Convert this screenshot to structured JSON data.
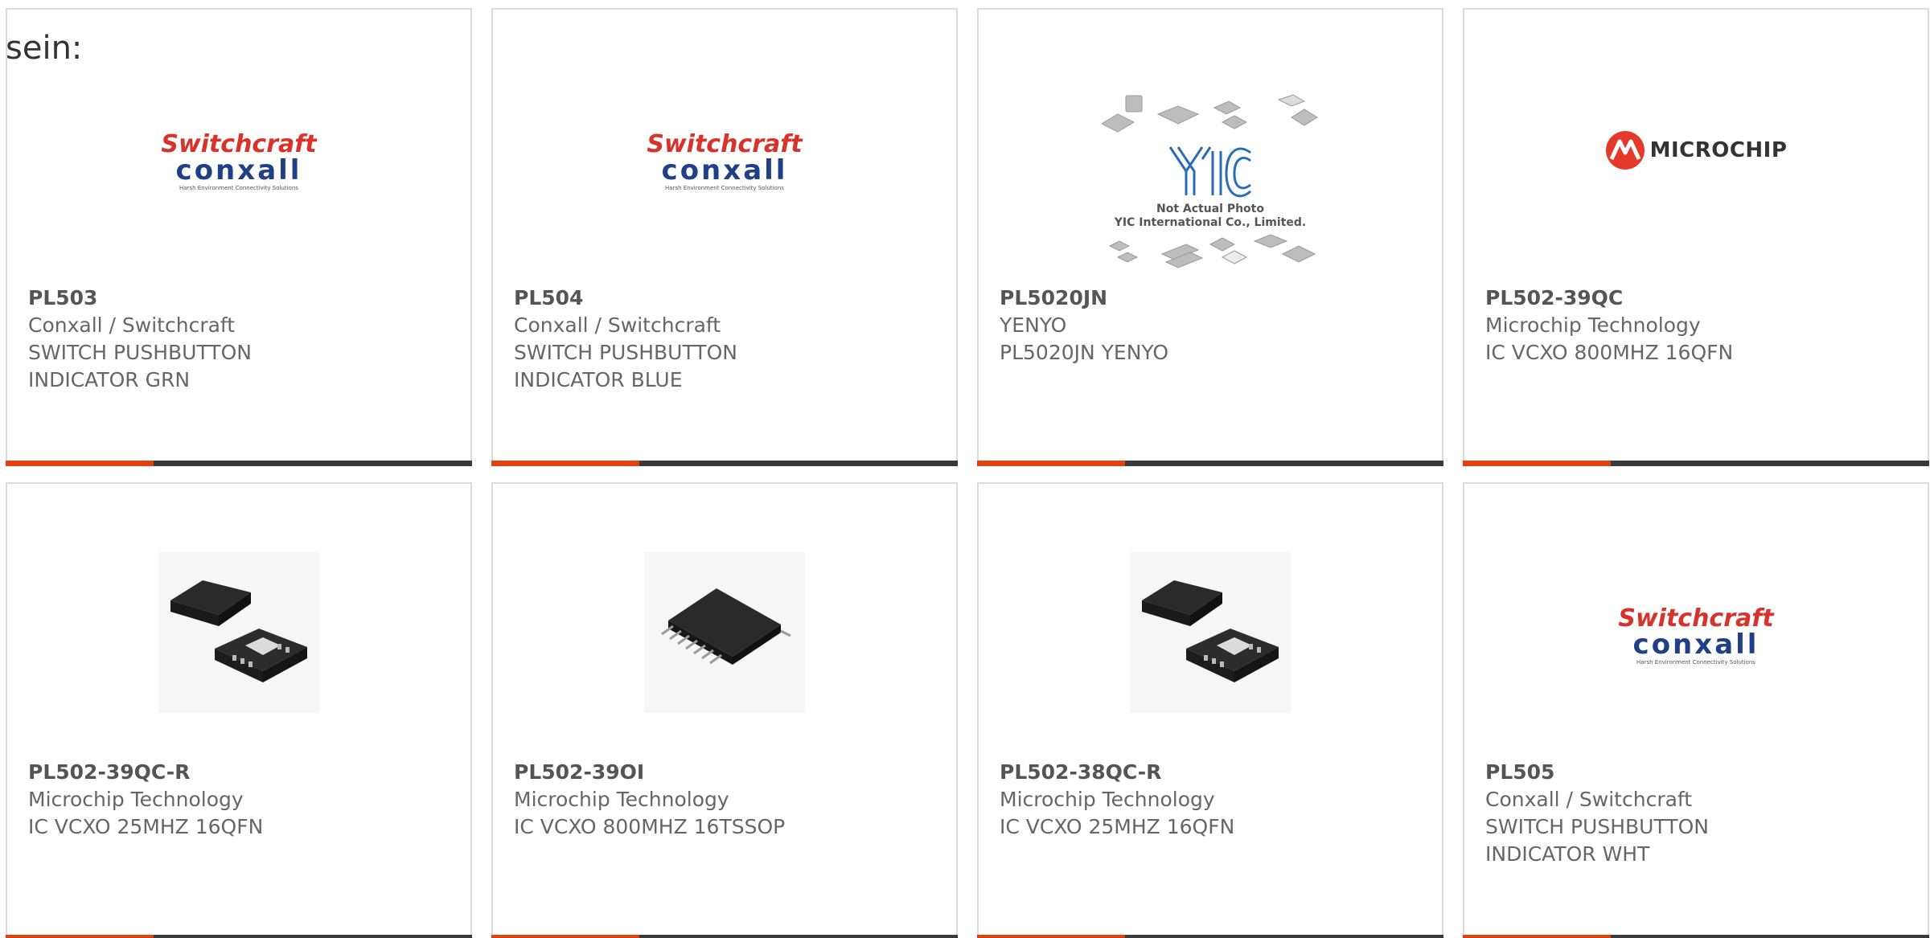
{
  "intro_text": "sein:",
  "colors": {
    "accent": "#e2400f",
    "bar": "#3a3a3a",
    "border": "#dcdcdc",
    "text": "#666666"
  },
  "products": [
    {
      "part_number": "PL503",
      "manufacturer": "Conxall / Switchcraft",
      "description_1": "SWITCH PUSHBUTTON",
      "description_2": "INDICATOR GRN",
      "image": "switchcraft-conxall-logo",
      "logo_text_1": "Switchcraft",
      "logo_text_2": "conxall",
      "logo_tagline": "Harsh Environment Connectivity Solutions"
    },
    {
      "part_number": "PL504",
      "manufacturer": "Conxall / Switchcraft",
      "description_1": "SWITCH PUSHBUTTON",
      "description_2": "INDICATOR BLUE",
      "image": "switchcraft-conxall-logo",
      "logo_text_1": "Switchcraft",
      "logo_text_2": "conxall",
      "logo_tagline": "Harsh Environment Connectivity Solutions"
    },
    {
      "part_number": "PL5020JN",
      "manufacturer": "YENYO",
      "description_1": "PL5020JN YENYO",
      "description_2": "",
      "image": "yic-placeholder",
      "logo_text_1": "Not Actual Photo",
      "logo_text_2": "YIC International Co., Limited."
    },
    {
      "part_number": "PL502-39QC",
      "manufacturer": "Microchip Technology",
      "description_1": "IC VCXO 800MHZ 16QFN",
      "description_2": "",
      "image": "microchip-logo",
      "logo_text_1": "MICROCHIP"
    },
    {
      "part_number": "PL502-39QC-R",
      "manufacturer": "Microchip Technology",
      "description_1": "IC VCXO 25MHZ 16QFN",
      "description_2": "",
      "image": "qfn-chip-photo"
    },
    {
      "part_number": "PL502-39OI",
      "manufacturer": "Microchip Technology",
      "description_1": "IC VCXO 800MHZ 16TSSOP",
      "description_2": "",
      "image": "tssop-chip-photo"
    },
    {
      "part_number": "PL502-38QC-R",
      "manufacturer": "Microchip Technology",
      "description_1": "IC VCXO 25MHZ 16QFN",
      "description_2": "",
      "image": "qfn-chip-photo"
    },
    {
      "part_number": "PL505",
      "manufacturer": "Conxall / Switchcraft",
      "description_1": "SWITCH PUSHBUTTON",
      "description_2": "INDICATOR WHT",
      "image": "switchcraft-conxall-logo",
      "logo_text_1": "Switchcraft",
      "logo_text_2": "conxall",
      "logo_tagline": "Harsh Environment Connectivity Solutions"
    }
  ]
}
